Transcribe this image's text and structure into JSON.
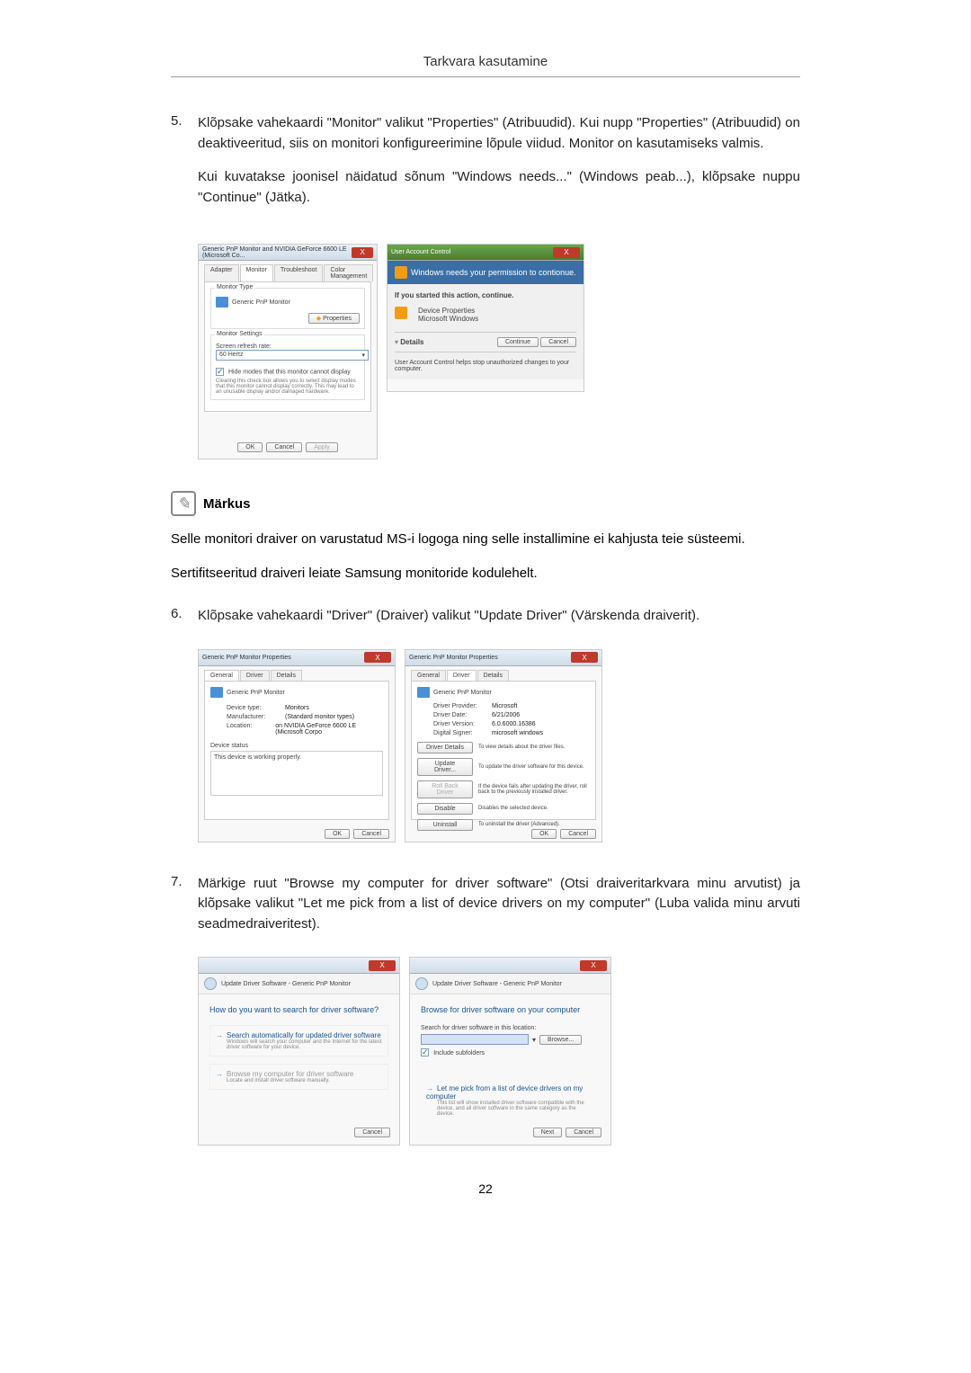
{
  "header": "Tarkvara kasutamine",
  "page_number": "22",
  "step5": {
    "num": "5.",
    "para1": "Klõpsake vahekaardi \"Monitor\" valikut \"Properties\" (Atribuudid). Kui nupp \"Properties\" (Atribuudid) on deaktiveeritud, siis on monitori konfigureerimine lõpule viidud. Monitor on kasutamiseks valmis.",
    "para2": "Kui kuvatakse joonisel näidatud sõnum \"Windows needs...\" (Windows peab...), klõpsake nuppu \"Continue\" (Jätka)."
  },
  "note": {
    "title": "Märkus",
    "para1": "Selle monitori draiver on varustatud MS-i logoga ning selle installimine ei kahjusta teie süsteemi.",
    "para2": "Sertifitseeritud draiveri leiate Samsung monitoride kodulehelt."
  },
  "step6": {
    "num": "6.",
    "text": "Klõpsake vahekaardi \"Driver\" (Draiver) valikut \"Update Driver\" (Värskenda draiverit)."
  },
  "step7": {
    "num": "7.",
    "text": "Märkige ruut \"Browse my computer for driver software\" (Otsi draiveritarkvara minu arvutist) ja klõpsake valikut \"Let me pick from a list of device drivers on my computer\" (Luba valida minu arvuti seadmedraiveritest)."
  },
  "dlg1": {
    "title": "Generic PnP Monitor and NVIDIA GeForce 6600 LE (Microsoft Co...",
    "tabs": [
      "Adapter",
      "Monitor",
      "Troubleshoot",
      "Color Management"
    ],
    "monitor_type_label": "Monitor Type",
    "monitor_name": "Generic PnP Monitor",
    "properties_btn": "Properties",
    "settings_label": "Monitor Settings",
    "refresh_label": "Screen refresh rate:",
    "refresh_value": "60 Hertz",
    "hide_modes": "Hide modes that this monitor cannot display",
    "hide_desc": "Clearing this check box allows you to select display modes that this monitor cannot display correctly. This may lead to an unusable display and/or damaged hardware.",
    "ok": "OK",
    "cancel": "Cancel",
    "apply": "Apply"
  },
  "dlg2": {
    "title": "User Account Control",
    "banner": "Windows needs your permission to contionue.",
    "started": "If you started this action, continue.",
    "device_props": "Device Properties",
    "ms_windows": "Microsoft Windows",
    "details": "Details",
    "continue": "Continue",
    "cancel": "Cancel",
    "footer": "User Account Control helps stop unauthorized changes to your computer."
  },
  "dlg3": {
    "title": "Generic PnP Monitor Properties",
    "tabs": [
      "General",
      "Driver",
      "Details"
    ],
    "name": "Generic PnP Monitor",
    "rows": [
      {
        "label": "Device type:",
        "value": "Monitors"
      },
      {
        "label": "Manufacturer:",
        "value": "(Standard monitor types)"
      },
      {
        "label": "Location:",
        "value": "on NVIDIA GeForce 6600 LE (Microsoft Corpo"
      }
    ],
    "status_label": "Device status",
    "status_text": "This device is working properly.",
    "ok": "OK",
    "cancel": "Cancel"
  },
  "dlg4": {
    "title": "Generic PnP Monitor Properties",
    "tabs": [
      "General",
      "Driver",
      "Details"
    ],
    "name": "Generic PnP Monitor",
    "rows": [
      {
        "label": "Driver Provider:",
        "value": "Microsoft"
      },
      {
        "label": "Driver Date:",
        "value": "6/21/2006"
      },
      {
        "label": "Driver Version:",
        "value": "6.0.6000.16386"
      },
      {
        "label": "Digital Signer:",
        "value": "microsoft windows"
      }
    ],
    "buttons": [
      {
        "label": "Driver Details",
        "desc": "To view details about the driver files."
      },
      {
        "label": "Update Driver...",
        "desc": "To update the driver software for this device."
      },
      {
        "label": "Roll Back Driver",
        "desc": "If the device fails after updating the driver, roll back to the previously installed driver."
      },
      {
        "label": "Disable",
        "desc": "Disables the selected device."
      },
      {
        "label": "Uninstall",
        "desc": "To uninstall the driver (Advanced)."
      }
    ],
    "ok": "OK",
    "cancel": "Cancel"
  },
  "dlg5": {
    "breadcrumb": "Update Driver Software - Generic PnP Monitor",
    "heading": "How do you want to search for driver software?",
    "opt1_title": "Search automatically for updated driver software",
    "opt1_desc": "Windows will search your computer and the Internet for the latest driver software for your device.",
    "opt2_title": "Browse my computer for driver software",
    "opt2_desc": "Locate and install driver software manually.",
    "cancel": "Cancel"
  },
  "dlg6": {
    "breadcrumb": "Update Driver Software - Generic PnP Monitor",
    "heading": "Browse for driver software on your computer",
    "search_label": "Search for driver software in this location:",
    "browse": "Browse...",
    "include": "Include subfolders",
    "opt_title": "Let me pick from a list of device drivers on my computer",
    "opt_desc": "This list will show installed driver software compatible with the device, and all driver software in the same category as the device.",
    "next": "Next",
    "cancel": "Cancel"
  }
}
